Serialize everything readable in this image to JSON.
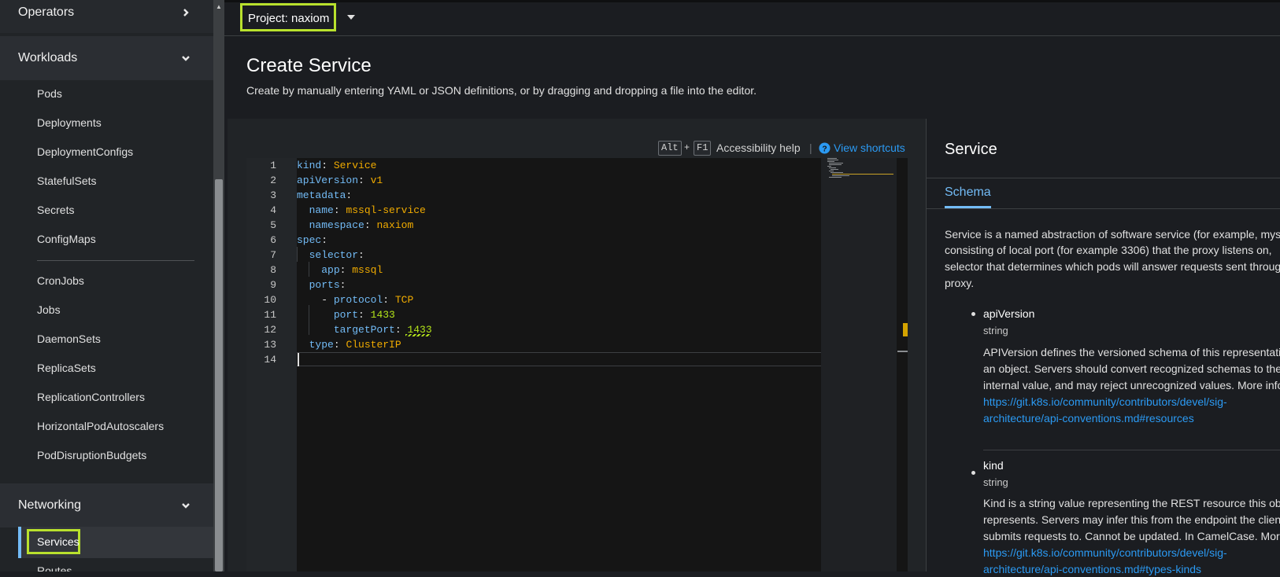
{
  "sidebar": {
    "operators": "Operators",
    "workloads": "Workloads",
    "workload_items": [
      "Pods",
      "Deployments",
      "DeploymentConfigs",
      "StatefulSets",
      "Secrets",
      "ConfigMaps"
    ],
    "workload_items2": [
      "CronJobs",
      "Jobs",
      "DaemonSets",
      "ReplicaSets",
      "ReplicationControllers",
      "HorizontalPodAutoscalers",
      "PodDisruptionBudgets"
    ],
    "networking": "Networking",
    "services": "Services",
    "routes": "Routes"
  },
  "topbar": {
    "project": "Project: naxiom"
  },
  "page": {
    "title": "Create Service",
    "description": "Create by manually entering YAML or JSON definitions, or by dragging and dropping a file into the editor."
  },
  "editor_toolbar": {
    "key1": "Alt",
    "plus": "+",
    "key2": "F1",
    "accessibility_help": "Accessibility help",
    "separator": "|",
    "view_shortcuts": "View shortcuts"
  },
  "editor": {
    "line_numbers": [
      "1",
      "2",
      "3",
      "4",
      "5",
      "6",
      "7",
      "8",
      "9",
      "10",
      "11",
      "12",
      "13",
      "14"
    ],
    "lines": [
      {
        "k": "kind",
        "v": "Service"
      },
      {
        "k": "apiVersion",
        "v": "v1"
      },
      {
        "k": "metadata",
        "v": ""
      },
      {
        "k": "  name",
        "v": "mssql-service"
      },
      {
        "k": "  namespace",
        "v": "naxiom"
      },
      {
        "k": "spec",
        "v": ""
      },
      {
        "k": "  selector",
        "v": ""
      },
      {
        "k": "    app",
        "v": "mssql"
      },
      {
        "k": "  ports",
        "v": ""
      },
      {
        "k": "    - protocol",
        "v": "TCP"
      },
      {
        "k": "      port",
        "v": "1433"
      },
      {
        "k": "      targetPort",
        "v": "1433"
      },
      {
        "k": "  type",
        "v": "ClusterIP"
      },
      {
        "k": "",
        "v": ""
      }
    ]
  },
  "panel": {
    "title": "Service",
    "tab": "Schema",
    "description_lines": [
      "Service is a named abstraction of software service (for example, mys",
      "consisting of local port (for example 3306) that the proxy listens on,",
      "selector that determines which pods will answer requests sent throug",
      "proxy."
    ],
    "fields": [
      {
        "name": "apiVersion",
        "type": "string",
        "desc_lines": [
          "APIVersion defines the versioned schema of this representati",
          "an object. Servers should convert recognized schemas to the",
          "internal value, and may reject unrecognized values. More info"
        ],
        "link_lines": [
          "https://git.k8s.io/community/contributors/devel/sig-",
          "architecture/api-conventions.md#resources"
        ]
      },
      {
        "name": "kind",
        "type": "string",
        "desc_lines": [
          "Kind is a string value representing the REST resource this obj",
          "represents. Servers may infer this from the endpoint the clien",
          "submits requests to. Cannot be updated. In CamelCase. More"
        ],
        "link_lines": [
          "https://git.k8s.io/community/contributors/devel/sig-",
          "architecture/api-conventions.md#types-kinds"
        ]
      }
    ]
  },
  "colors": {
    "highlight": "#b9e12d",
    "link": "#2b9af3",
    "key": "#73bcf7",
    "value": "#f0ab00",
    "number": "#b5e61a"
  }
}
